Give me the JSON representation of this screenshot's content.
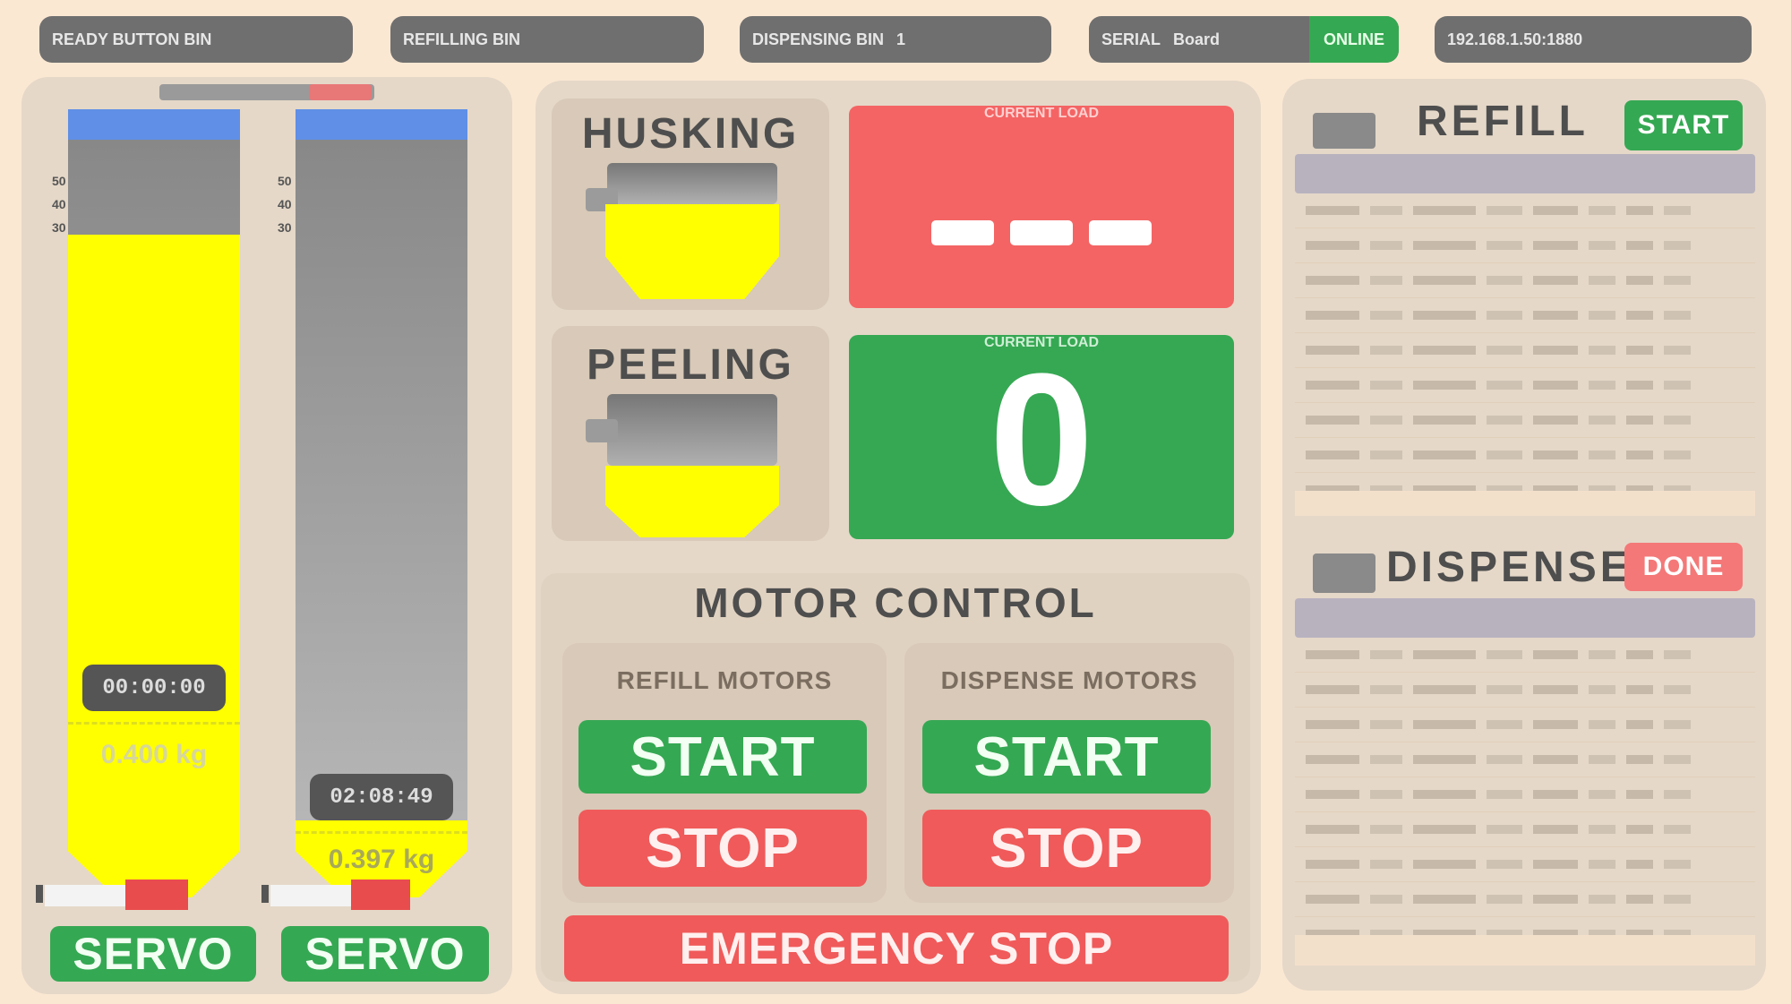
{
  "status_bar": {
    "items": [
      {
        "label": "READY BUTTON BIN",
        "value": "",
        "chip": ""
      },
      {
        "label": "REFILLING BIN",
        "value": "",
        "chip": ""
      },
      {
        "label": "DISPENSING BIN",
        "value": "1",
        "chip": ""
      },
      {
        "label": "SERIAL",
        "value": "Board",
        "chip": "ONLINE"
      },
      {
        "label": "192.168.1.50:1880",
        "value": "",
        "chip": ""
      }
    ]
  },
  "tanks": [
    {
      "time": "00:00:00",
      "weight": "0.400 kg",
      "fill_percent": 86,
      "scale": [
        "50",
        "40",
        "30"
      ]
    },
    {
      "time": "02:08:49",
      "weight": "0.397 kg",
      "fill_percent": 0,
      "scale": [
        "50",
        "40",
        "30"
      ]
    }
  ],
  "servo_label": "SERVO",
  "machine": {
    "husking": {
      "title": "HUSKING",
      "status_label": "CURRENT LOAD",
      "display": "---"
    },
    "peeling": {
      "title": "PEELING",
      "status_label": "CURRENT LOAD",
      "display": "0"
    }
  },
  "motor_control": {
    "title": "MOTOR CONTROL",
    "refill": {
      "title": "REFILL MOTORS",
      "start": "START",
      "stop": "STOP"
    },
    "dispense": {
      "title": "DISPENSE MOTORS",
      "start": "START",
      "stop": "STOP"
    },
    "emergency": "EMERGENCY STOP"
  },
  "refill_panel": {
    "title": "REFILL",
    "badge": "START",
    "rows": 9
  },
  "dispense_panel": {
    "title": "DISPENSE",
    "badge": "DONE",
    "rows": 9
  },
  "colors": {
    "green": "#35a853",
    "red": "#f05a5a",
    "yellow": "#ffff00",
    "blue": "#5f8fe6",
    "background": "#fbe8d3"
  }
}
